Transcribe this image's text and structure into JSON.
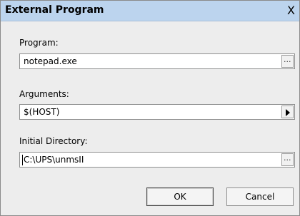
{
  "window": {
    "title": "External Program",
    "close_glyph": "X"
  },
  "program": {
    "label": "Program:",
    "value": "notepad.exe",
    "browse_label": "..."
  },
  "arguments": {
    "label": "Arguments:",
    "value": "$(HOST)",
    "icon": "arrow-right-icon"
  },
  "directory": {
    "label": "Initial Directory:",
    "value": "C:\\UPS\\unmsII",
    "browse_label": "..."
  },
  "buttons": {
    "ok": "OK",
    "cancel": "Cancel"
  }
}
